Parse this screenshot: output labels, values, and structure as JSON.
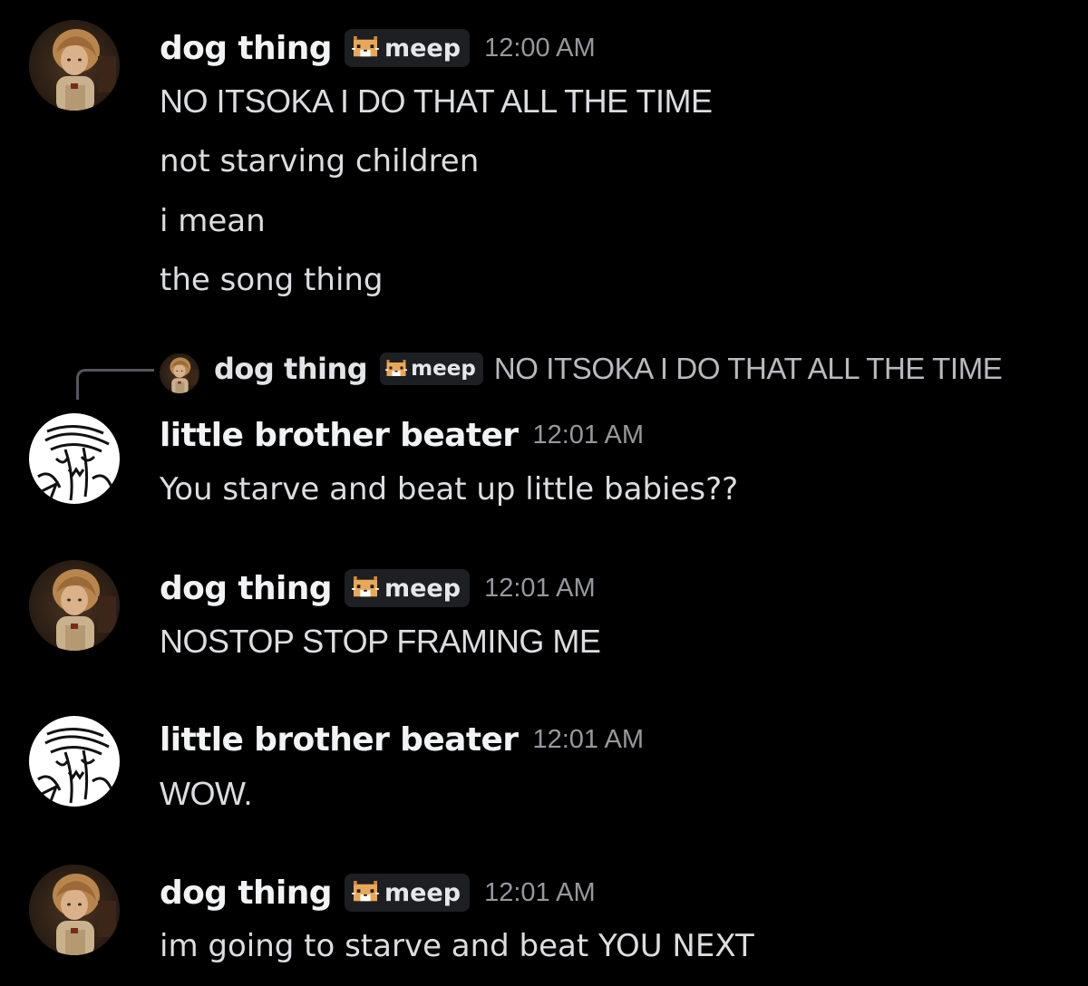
{
  "tag": {
    "label": "meep",
    "icon": "pixel-cat-icon"
  },
  "reply": {
    "username": "dog thing",
    "tag_label": "meep",
    "preview": "NO ITSOKA I DO THAT ALL THE TIME"
  },
  "messages": [
    {
      "username": "dog thing",
      "avatar": "girl-portrait-avatar",
      "has_tag": true,
      "timestamp": "12:00 AM",
      "lines": [
        "NO ITSOKA I DO THAT ALL THE TIME",
        "not starving children",
        "i mean",
        "the song thing"
      ]
    },
    {
      "username": "little brother beater",
      "avatar": "sketch-face-avatar",
      "has_tag": false,
      "timestamp": "12:01 AM",
      "lines": [
        "You starve and beat up little babies??"
      ]
    },
    {
      "username": "dog thing",
      "avatar": "girl-portrait-avatar",
      "has_tag": true,
      "timestamp": "12:01 AM",
      "lines": [
        "NOSTOP STOP FRAMING ME"
      ]
    },
    {
      "username": "little brother beater",
      "avatar": "sketch-face-avatar",
      "has_tag": false,
      "timestamp": "12:01 AM",
      "lines": [
        "WOW."
      ]
    },
    {
      "username": "dog thing",
      "avatar": "girl-portrait-avatar",
      "has_tag": true,
      "timestamp": "12:01 AM",
      "lines": [
        "im going to starve and beat YOU NEXT"
      ]
    }
  ]
}
